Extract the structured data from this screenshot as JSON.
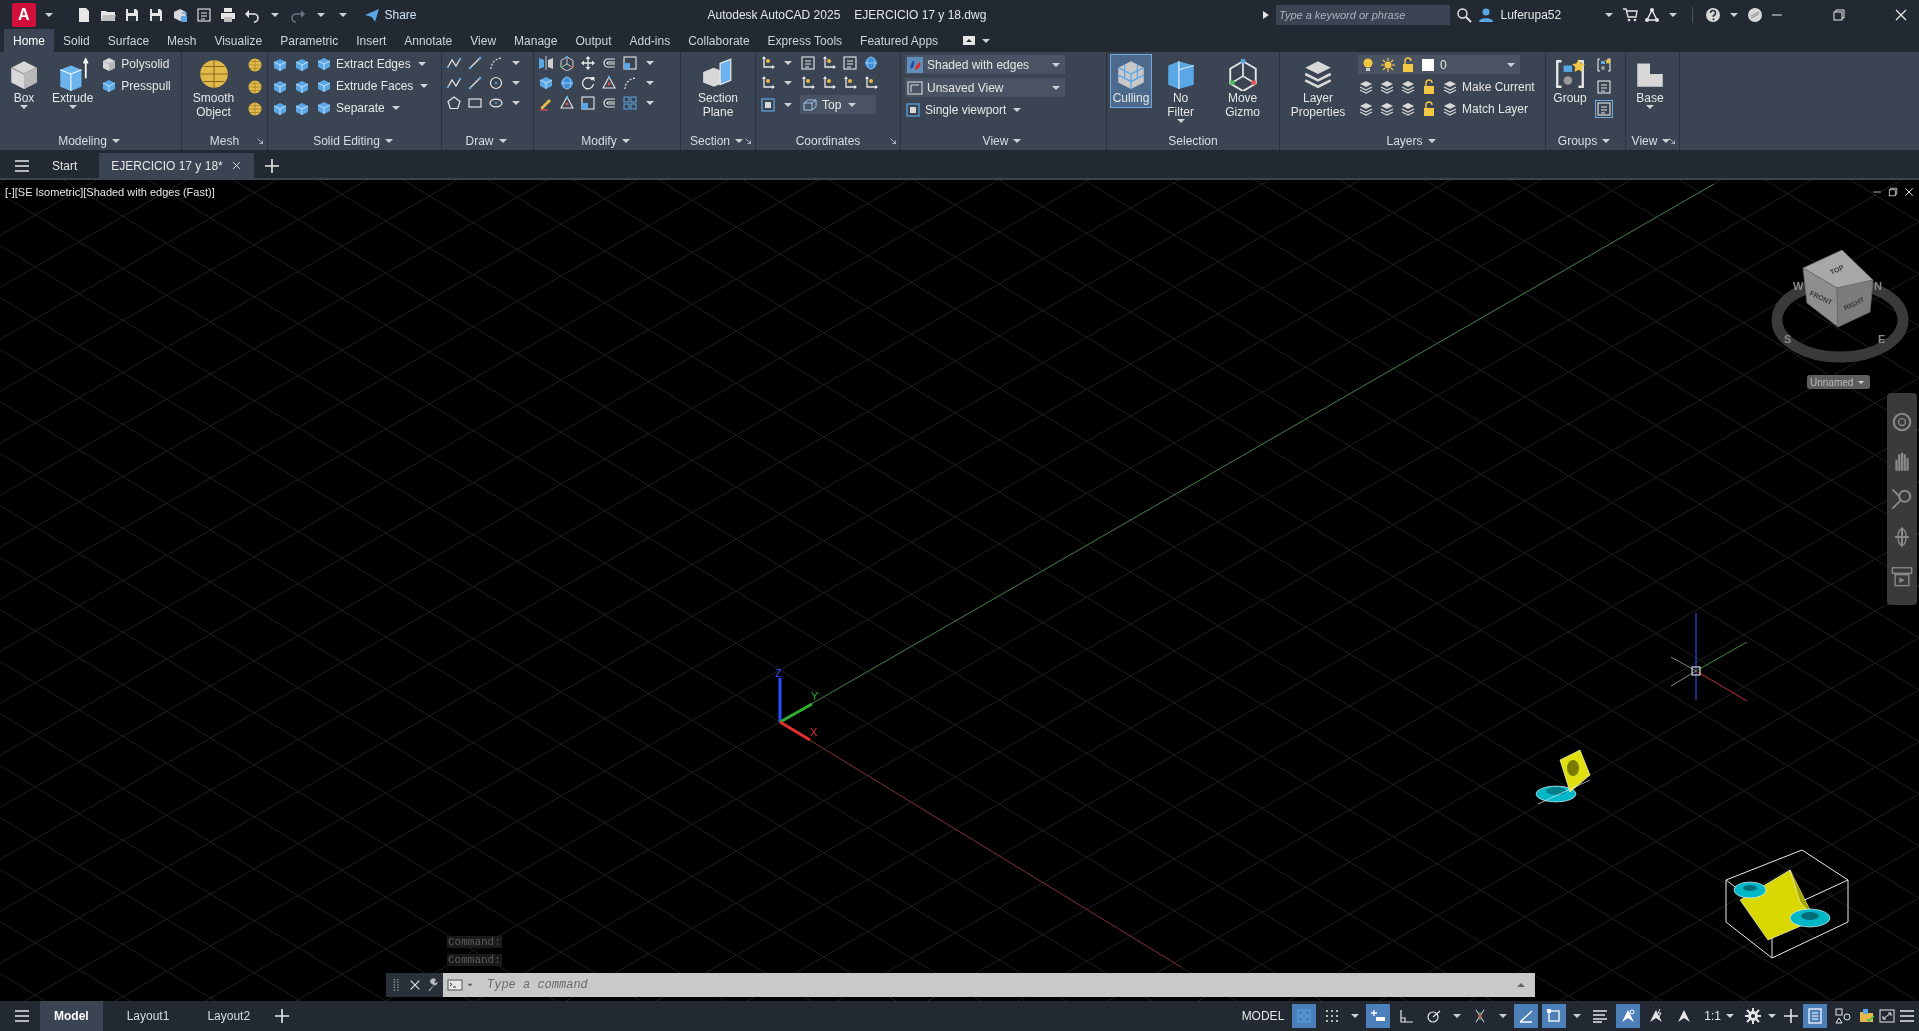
{
  "title_bar": {
    "app_logo": "A",
    "share": "Share",
    "app_title": "Autodesk AutoCAD 2025",
    "file_name": "EJERCICIO 17 y 18.dwg",
    "search_placeholder": "Type a keyword or phrase",
    "user": "Luferupa52"
  },
  "ribbon_tabs": [
    {
      "label": "Home",
      "selected": true
    },
    {
      "label": "Solid",
      "selected": false
    },
    {
      "label": "Surface",
      "selected": false
    },
    {
      "label": "Mesh",
      "selected": false
    },
    {
      "label": "Visualize",
      "selected": false
    },
    {
      "label": "Parametric",
      "selected": false
    },
    {
      "label": "Insert",
      "selected": false
    },
    {
      "label": "Annotate",
      "selected": false
    },
    {
      "label": "View",
      "selected": false
    },
    {
      "label": "Manage",
      "selected": false
    },
    {
      "label": "Output",
      "selected": false
    },
    {
      "label": "Add-ins",
      "selected": false
    },
    {
      "label": "Collaborate",
      "selected": false
    },
    {
      "label": "Express Tools",
      "selected": false
    },
    {
      "label": "Featured Apps",
      "selected": false
    }
  ],
  "ribbon_panels": [
    {
      "title": "Modeling",
      "tools": [
        {
          "label": "Box"
        },
        {
          "label": "Extrude"
        },
        {
          "label": "Polysolid"
        },
        {
          "label": "Presspull"
        }
      ]
    },
    {
      "title": "Mesh",
      "tools": [
        {
          "label": "Smooth Object"
        }
      ]
    },
    {
      "title": "Solid Editing",
      "tools": [
        {
          "label": "Extract Edges"
        },
        {
          "label": "Extrude Faces"
        },
        {
          "label": "Separate"
        }
      ]
    },
    {
      "title": "Draw"
    },
    {
      "title": "Modify"
    },
    {
      "title": "Section",
      "tools": [
        {
          "label": "Section Plane"
        }
      ]
    },
    {
      "title": "Coordinates",
      "tools": [
        {
          "label": "Top"
        }
      ]
    },
    {
      "title": "View",
      "tools": [
        {
          "label": "Shaded with edges"
        },
        {
          "label": "Unsaved View"
        },
        {
          "label": "Single viewport"
        }
      ]
    },
    {
      "title": "Selection",
      "tools": [
        {
          "label": "Culling",
          "on": true
        },
        {
          "label": "No Filter",
          "on": false
        },
        {
          "label": "Move Gizmo",
          "on": false
        }
      ]
    },
    {
      "title": "Layers",
      "tools": [
        {
          "label": "Layer Properties"
        },
        {
          "label": "0"
        },
        {
          "label": "Make Current"
        },
        {
          "label": "Match Layer"
        }
      ]
    },
    {
      "title": "Groups",
      "tools": [
        {
          "label": "Group"
        }
      ]
    },
    {
      "title": "View",
      "tools": [
        {
          "label": "Base"
        }
      ]
    }
  ],
  "file_tabs": [
    {
      "label": "Start",
      "selected": false
    },
    {
      "label": "EJERCICIO 17 y 18*",
      "selected": true
    }
  ],
  "viewport": {
    "controls": [
      "[-]",
      "[SE Isometric]",
      "[Shaded with edges (Fast)]"
    ],
    "ucs_labels": [
      "Z",
      "Y",
      "X"
    ],
    "viewcube": {
      "faces": [
        "TOP",
        "FRONT",
        "RIGHT"
      ],
      "compass": [
        "W",
        "N",
        "S",
        "E"
      ],
      "view_name": "Unnamed"
    }
  },
  "command_line": {
    "history": [
      "Command:",
      "Command:"
    ],
    "placeholder": "Type a command"
  },
  "layout_tabs": [
    {
      "label": "Model",
      "selected": true
    },
    {
      "label": "Layout1",
      "selected": false
    },
    {
      "label": "Layout2",
      "selected": false
    }
  ],
  "status_bar": {
    "space": "MODEL",
    "scale": "1:1",
    "toggles": [
      {
        "on": true
      },
      {
        "on": false
      },
      {
        "on": true
      },
      {
        "on": false
      },
      {
        "on": false
      },
      {
        "on": false
      },
      {
        "on": true
      },
      {
        "on": true
      },
      {
        "on": false
      },
      {
        "on": true
      },
      {
        "on": false
      },
      {
        "on": false
      },
      {
        "on": true
      },
      {
        "on": false
      }
    ]
  }
}
